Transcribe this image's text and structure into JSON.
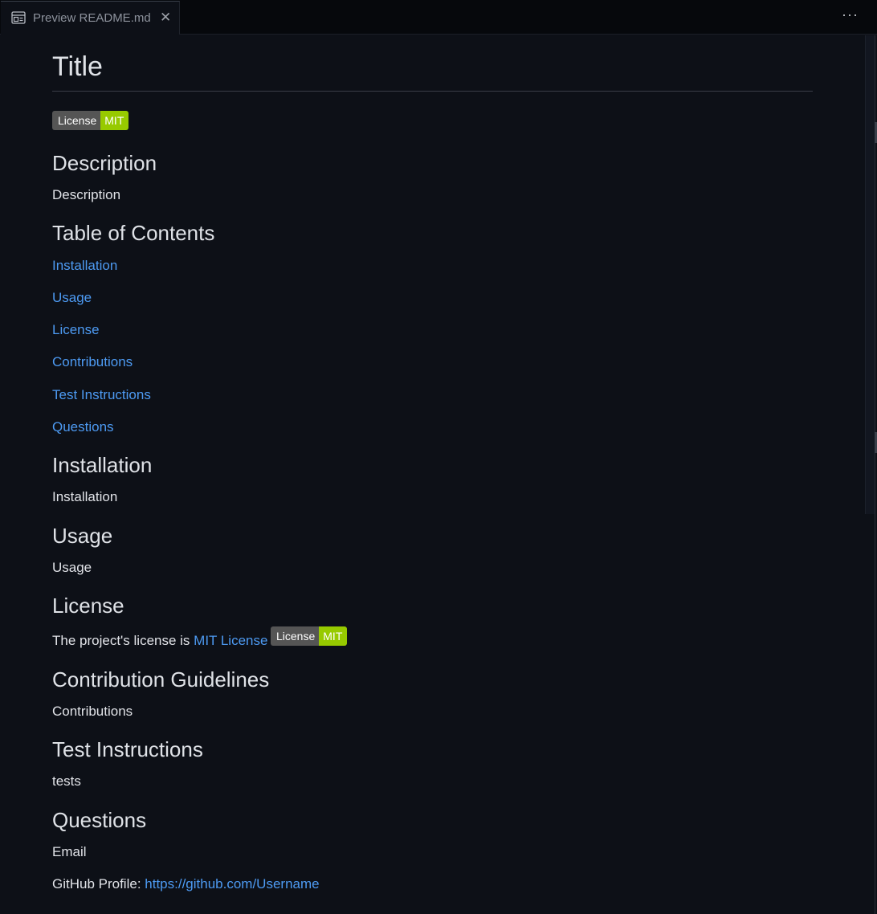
{
  "tab": {
    "icon": "preview-icon",
    "label": "Preview README.md",
    "close": "✕"
  },
  "toolbar": {
    "more": "···"
  },
  "doc": {
    "title": "Title",
    "badge": {
      "left": "License",
      "right": "MIT"
    },
    "description_heading": "Description",
    "description_text": "Description",
    "toc_heading": "Table of Contents",
    "toc": [
      "Installation",
      "Usage",
      "License",
      "Contributions",
      "Test Instructions",
      "Questions"
    ],
    "installation_heading": "Installation",
    "installation_text": "Installation",
    "usage_heading": "Usage",
    "usage_text": "Usage",
    "license_heading": "License",
    "license_prefix": "The project's license is ",
    "license_link": "MIT License",
    "contrib_heading": "Contribution Guidelines",
    "contrib_text": "Contributions",
    "tests_heading": "Test Instructions",
    "tests_text": "tests",
    "questions_heading": "Questions",
    "email_text": "Email",
    "github_prefix": "GitHub Profile: ",
    "github_link": "https://github.com/Username"
  },
  "colors": {
    "background": "#0d1017",
    "link": "#4d9af2",
    "badge_left": "#555555",
    "badge_right": "#97ca00"
  }
}
